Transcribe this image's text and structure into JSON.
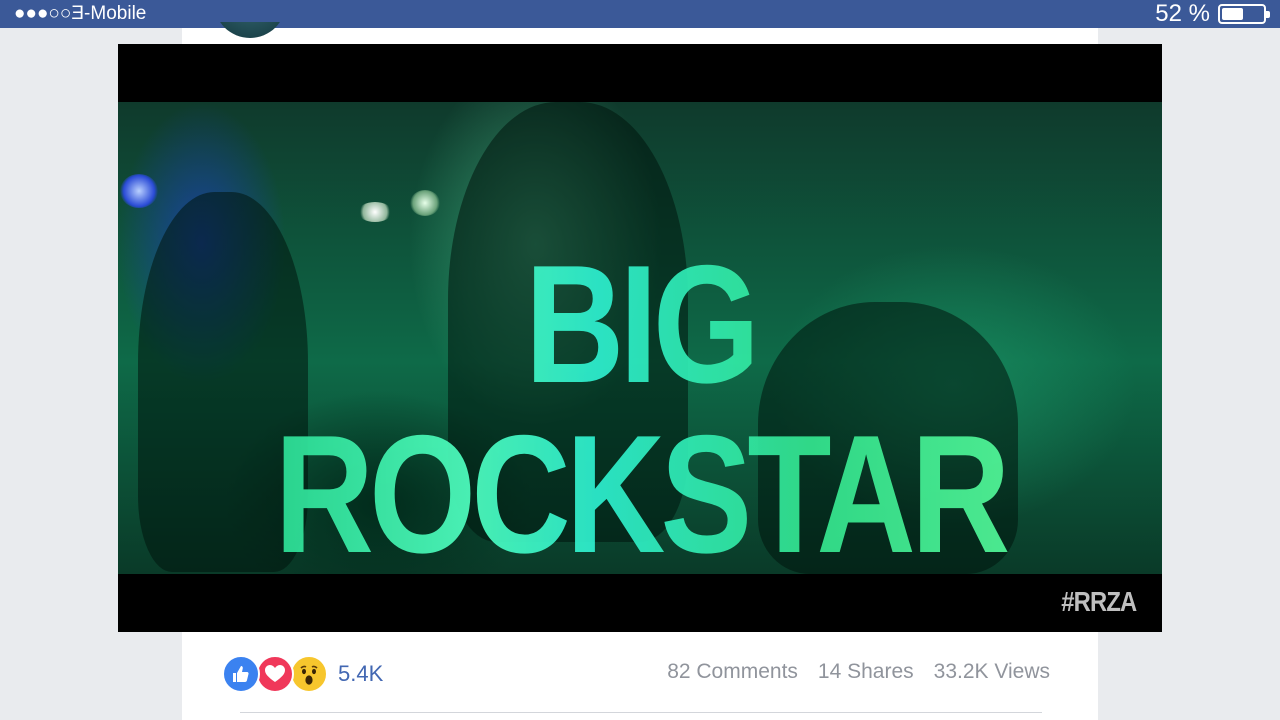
{
  "status_bar": {
    "carrier": "●●●○○Ǝ-Mobile",
    "battery_percent": "52 %",
    "battery_level": 0.52
  },
  "video": {
    "headline": "BIG ROCKSTAR",
    "hashtag": "#RRZA"
  },
  "reactions": {
    "icons": [
      "like-icon",
      "love-icon",
      "wow-icon"
    ],
    "count": "5.4K"
  },
  "stats": {
    "comments": "82 Comments",
    "shares": "14 Shares",
    "views": "33.2K Views"
  },
  "colors": {
    "status_bar": "#3b5998",
    "link_blue": "#4267b2",
    "muted_text": "#90949c",
    "like_blue": "#3b82f0",
    "love_red": "#f0385a",
    "wow_yellow": "#f7c62d"
  }
}
